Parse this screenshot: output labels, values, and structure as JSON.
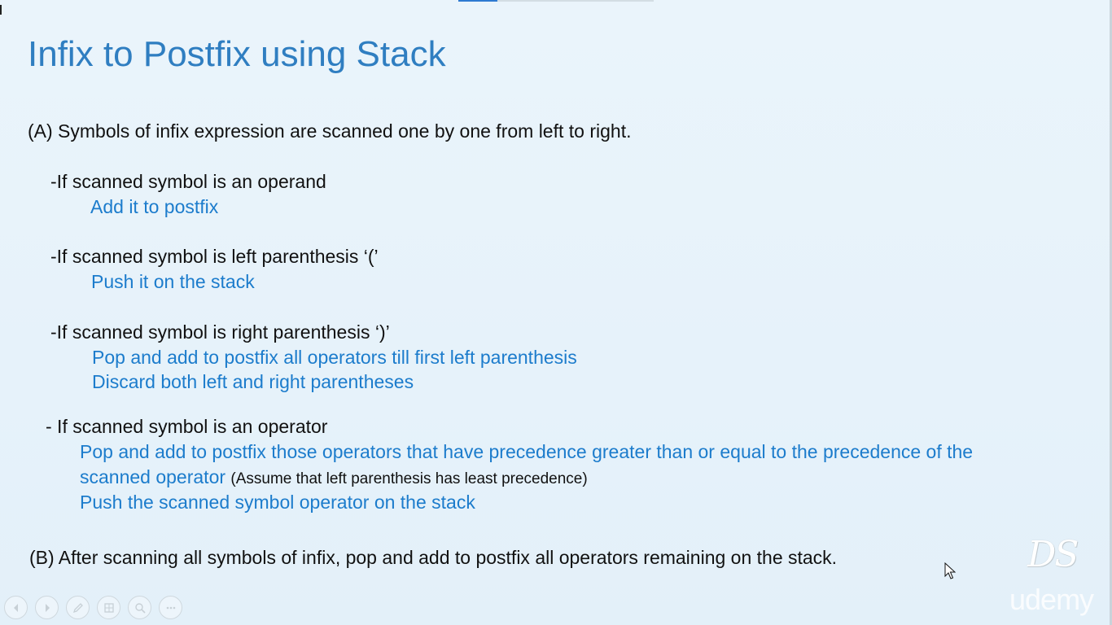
{
  "slide": {
    "title": "Infix to Postfix using Stack",
    "a_intro": "(A) Symbols of infix expression are scanned one by one from left to right.",
    "operand_rule": "-If scanned symbol is an operand",
    "operand_action": "Add it to postfix",
    "left_paren_rule": "-If scanned symbol is left parenthesis ‘(’",
    "left_paren_action": "Push it on the stack",
    "right_paren_rule": "-If scanned symbol is right parenthesis ‘)’",
    "right_paren_action_1": "Pop and add to postfix all operators till first left parenthesis",
    "right_paren_action_2": "Discard both left and right parentheses",
    "operator_rule": "- If scanned symbol is an operator",
    "operator_action_1a": "Pop and add to postfix those operators that have precedence greater than or equal to the precedence of the",
    "operator_action_1b": "scanned operator",
    "operator_note": "(Assume that left parenthesis has least precedence)",
    "operator_action_2": "Push the scanned symbol operator on the stack",
    "b_final": "(B) After scanning all symbols of infix, pop and add to postfix all operators remaining on the stack."
  },
  "watermarks": {
    "ds": "DS",
    "udemy": "udemy"
  },
  "player_controls": [
    {
      "name": "previous-icon"
    },
    {
      "name": "next-icon"
    },
    {
      "name": "pen-icon"
    },
    {
      "name": "slides-icon"
    },
    {
      "name": "zoom-icon"
    },
    {
      "name": "more-icon"
    }
  ],
  "colors": {
    "title": "#2f7ec1",
    "action_text": "#1c7ccc",
    "background": "#e8f3fa"
  }
}
